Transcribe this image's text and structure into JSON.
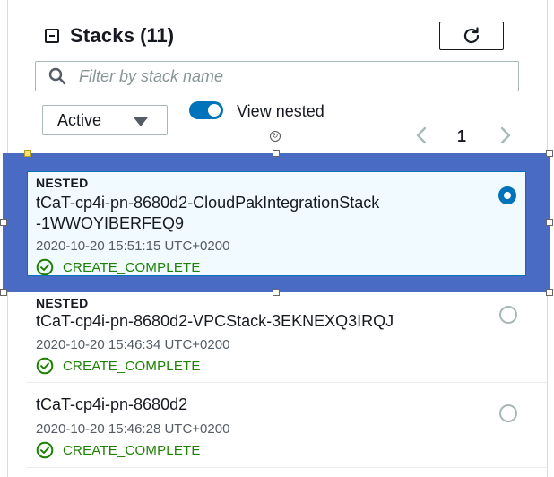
{
  "header": {
    "title": "Stacks",
    "count": "(11)"
  },
  "search": {
    "placeholder": "Filter by stack name",
    "value": ""
  },
  "filter": {
    "selected": "Active"
  },
  "view_nested": {
    "label": "View nested",
    "enabled": true
  },
  "pagination": {
    "current_page": "1"
  },
  "stacks": [
    {
      "tag": "NESTED",
      "name_line1": "tCaT-cp4i-pn-8680d2-CloudPakIntegrationStack",
      "name_line2": "-1WWOYIBERFEQ9",
      "date": "2020-10-20 15:51:15 UTC+0200",
      "status": "CREATE_COMPLETE",
      "selected": true
    },
    {
      "tag": "NESTED",
      "name_line1": "tCaT-cp4i-pn-8680d2-VPCStack-3EKNEXQ3IRQJ",
      "date": "2020-10-20 15:46:34 UTC+0200",
      "status": "CREATE_COMPLETE",
      "selected": false
    },
    {
      "name_line1": "tCaT-cp4i-pn-8680d2",
      "date": "2020-10-20 15:46:28 UTC+0200",
      "status": "CREATE_COMPLETE",
      "selected": false
    }
  ],
  "colors": {
    "accent": "#0073bb",
    "success": "#1d8102",
    "selection_frame": "#4a6bc4",
    "selected_bg": "#f1faff"
  },
  "icons": [
    "collapse-icon",
    "refresh-icon",
    "search-icon",
    "caret-down-icon",
    "chevron-left-icon",
    "chevron-right-icon",
    "check-circle-icon"
  ]
}
